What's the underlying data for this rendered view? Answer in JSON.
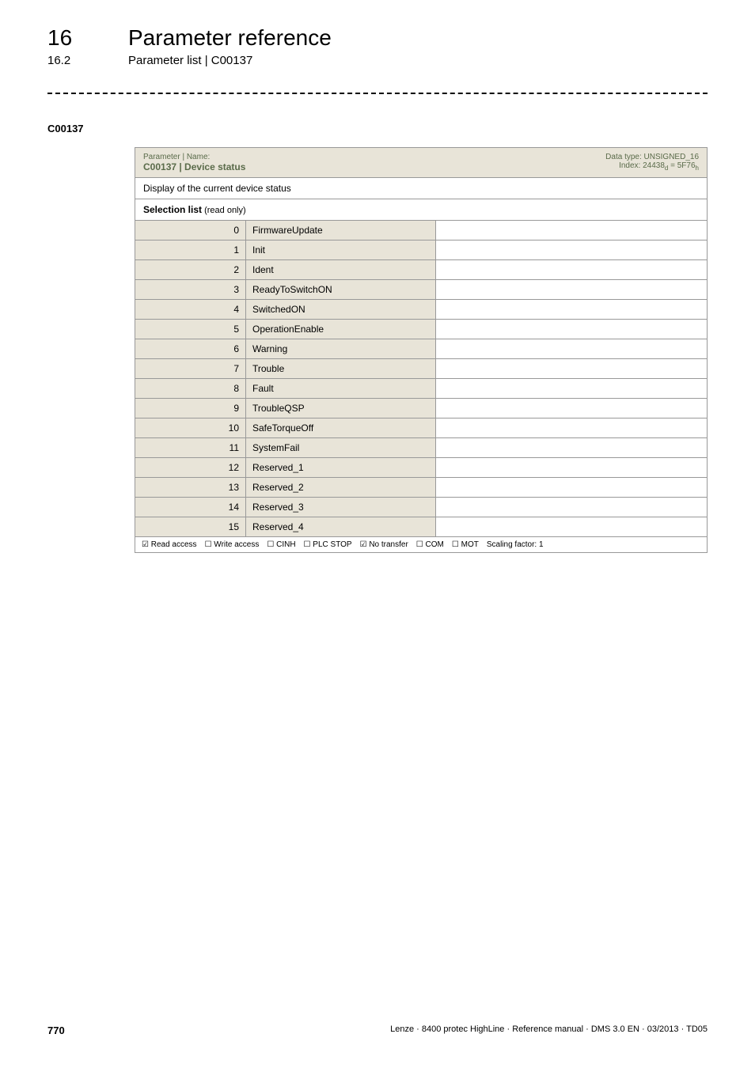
{
  "header": {
    "chapterNumber": "16",
    "chapterTitle": "Parameter reference",
    "sectionNumber": "16.2",
    "sectionTitle": "Parameter list | C00137"
  },
  "paramCode": "C00137",
  "paramBox": {
    "labelPrefix": "Parameter | Name:",
    "name": "C00137 | Device status",
    "dataType": "Data type: UNSIGNED_16",
    "index": "Index: 24438",
    "indexSubD": "d",
    "indexEq": " = 5F76",
    "indexSubH": "h",
    "description": "Display of the current device status",
    "selectionHeader": "Selection list",
    "readonly": " (read only)",
    "rows": [
      {
        "num": "0",
        "val": "FirmwareUpdate"
      },
      {
        "num": "1",
        "val": "Init"
      },
      {
        "num": "2",
        "val": "Ident"
      },
      {
        "num": "3",
        "val": "ReadyToSwitchON"
      },
      {
        "num": "4",
        "val": "SwitchedON"
      },
      {
        "num": "5",
        "val": "OperationEnable"
      },
      {
        "num": "6",
        "val": "Warning"
      },
      {
        "num": "7",
        "val": "Trouble"
      },
      {
        "num": "8",
        "val": "Fault"
      },
      {
        "num": "9",
        "val": "TroubleQSP"
      },
      {
        "num": "10",
        "val": "SafeTorqueOff"
      },
      {
        "num": "11",
        "val": "SystemFail"
      },
      {
        "num": "12",
        "val": "Reserved_1"
      },
      {
        "num": "13",
        "val": "Reserved_2"
      },
      {
        "num": "14",
        "val": "Reserved_3"
      },
      {
        "num": "15",
        "val": "Reserved_4"
      }
    ],
    "access": {
      "read": "☑ Read access",
      "write": "☐ Write access",
      "cinh": "☐ CINH",
      "plc": "☐ PLC STOP",
      "notransfer": "☑ No transfer",
      "com": "☐ COM",
      "mot": "☐ MOT",
      "scaling": "Scaling factor: 1"
    }
  },
  "footer": {
    "pageNum": "770",
    "docInfo": "Lenze · 8400 protec HighLine · Reference manual · DMS 3.0 EN · 03/2013 · TD05"
  }
}
